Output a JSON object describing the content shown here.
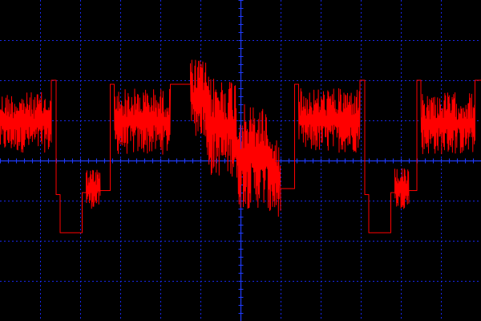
{
  "display": {
    "background": "#000000",
    "grid_color": "#1a2cff",
    "axis_color": "#1f3bff",
    "trace_color": "#ff0000"
  },
  "chart_data": {
    "type": "line",
    "title": "",
    "xlabel": "",
    "ylabel": "",
    "x_divisions": 12,
    "y_divisions": 8,
    "xlim": [
      0,
      12
    ],
    "ylim": [
      -4,
      4
    ],
    "grid": true,
    "center_axes": true,
    "series": [
      {
        "kind": "waveform",
        "segments": [
          {
            "x0": 0.0,
            "x1": 1.28,
            "level_high": 1.7,
            "level_low": 0.2,
            "noise": true
          },
          {
            "x0": 1.28,
            "x1": 1.4,
            "level_high": 2.0,
            "level_low": -0.6,
            "noise": false
          },
          {
            "x0": 1.4,
            "x1": 1.5,
            "level_high": -0.85,
            "level_low": -0.85,
            "noise": false
          },
          {
            "x0": 1.5,
            "x1": 2.05,
            "level_high": -1.8,
            "level_low": -1.8,
            "noise": false
          },
          {
            "x0": 2.05,
            "x1": 2.15,
            "level_high": -0.8,
            "level_low": -0.8,
            "noise": false
          },
          {
            "x0": 2.15,
            "x1": 2.5,
            "level_high": -0.2,
            "level_low": -1.2,
            "noise": true
          },
          {
            "x0": 2.5,
            "x1": 2.75,
            "level_high": -0.75,
            "level_low": -0.75,
            "noise": false
          },
          {
            "x0": 2.75,
            "x1": 2.85,
            "level_high": 1.9,
            "level_low": 1.9,
            "noise": false
          },
          {
            "x0": 2.85,
            "x1": 4.25,
            "level_high": 1.8,
            "level_low": 0.15,
            "noise": true
          },
          {
            "x0": 4.25,
            "x1": 4.75,
            "level_high": 1.9,
            "level_low": 1.9,
            "noise": false
          },
          {
            "x0": 4.75,
            "x1": 5.15,
            "level_high": 2.55,
            "level_low": 0.6,
            "noise": true
          },
          {
            "x0": 5.15,
            "x1": 5.9,
            "level_high": 2.1,
            "level_low": -0.4,
            "noise": true
          },
          {
            "x0": 5.9,
            "x1": 6.7,
            "level_high": 1.4,
            "level_low": -1.2,
            "noise": true
          },
          {
            "x0": 6.7,
            "x1": 7.0,
            "level_high": 0.6,
            "level_low": -1.4,
            "noise": true
          },
          {
            "x0": 7.0,
            "x1": 7.35,
            "level_high": -0.7,
            "level_low": -0.7,
            "noise": false
          },
          {
            "x0": 7.35,
            "x1": 7.45,
            "level_high": 1.9,
            "level_low": 1.9,
            "noise": false
          },
          {
            "x0": 7.45,
            "x1": 8.98,
            "level_high": 1.8,
            "level_low": 0.2,
            "noise": true
          },
          {
            "x0": 8.98,
            "x1": 9.1,
            "level_high": 2.0,
            "level_low": -0.6,
            "noise": false
          },
          {
            "x0": 9.1,
            "x1": 9.2,
            "level_high": -0.85,
            "level_low": -0.85,
            "noise": false
          },
          {
            "x0": 9.2,
            "x1": 9.75,
            "level_high": -1.8,
            "level_low": -1.8,
            "noise": false
          },
          {
            "x0": 9.75,
            "x1": 9.85,
            "level_high": -0.8,
            "level_low": -0.8,
            "noise": false
          },
          {
            "x0": 9.85,
            "x1": 10.2,
            "level_high": -0.2,
            "level_low": -1.2,
            "noise": true
          },
          {
            "x0": 10.2,
            "x1": 10.4,
            "level_high": -0.75,
            "level_low": -0.75,
            "noise": false
          },
          {
            "x0": 10.4,
            "x1": 10.5,
            "level_high": 2.0,
            "level_low": 2.0,
            "noise": false
          },
          {
            "x0": 10.5,
            "x1": 11.85,
            "level_high": 1.7,
            "level_low": 0.15,
            "noise": true
          },
          {
            "x0": 11.85,
            "x1": 12.0,
            "level_high": 2.0,
            "level_low": 0.2,
            "noise": false
          }
        ]
      }
    ]
  }
}
